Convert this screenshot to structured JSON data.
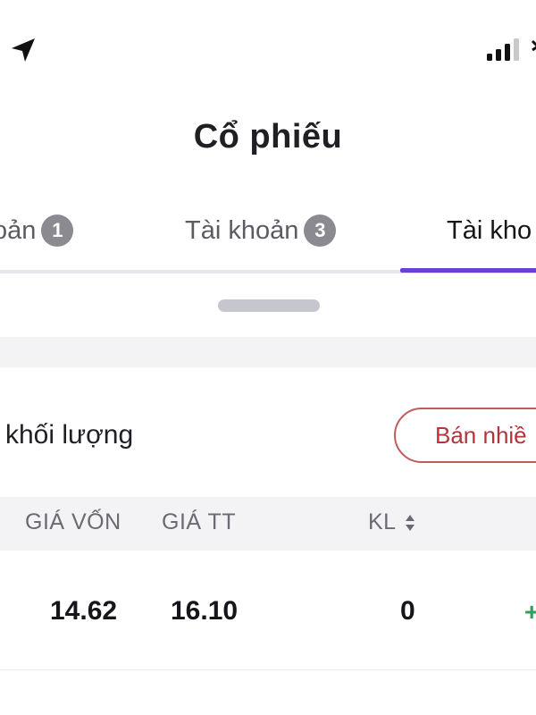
{
  "status_bar": {
    "location_icon": "location-arrow-icon",
    "signal_icon": "cellular-signal-icon",
    "wifi_icon": "wifi-icon"
  },
  "header": {
    "title": "Cổ phiếu"
  },
  "tabs": [
    {
      "label": "oản",
      "badge": "1",
      "active": false
    },
    {
      "label": "Tài khoản",
      "badge": "3",
      "active": false
    },
    {
      "label": "Tài kho",
      "badge": "",
      "active": true
    }
  ],
  "section": {
    "subtitle": "khối lượng",
    "sell_button_label": "Bán nhiề"
  },
  "table": {
    "headers": {
      "cost_price": "GIÁ VỐN",
      "market_price": "GIÁ TT",
      "volume": "KL"
    },
    "rows": [
      {
        "cost_price": "14.62",
        "market_price": "16.10",
        "volume": "0",
        "action": "+"
      }
    ]
  },
  "colors": {
    "accent": "#6a3fd6",
    "sell": "#b3353b",
    "positive": "#2f9e5a",
    "badge": "#8a8a90"
  }
}
